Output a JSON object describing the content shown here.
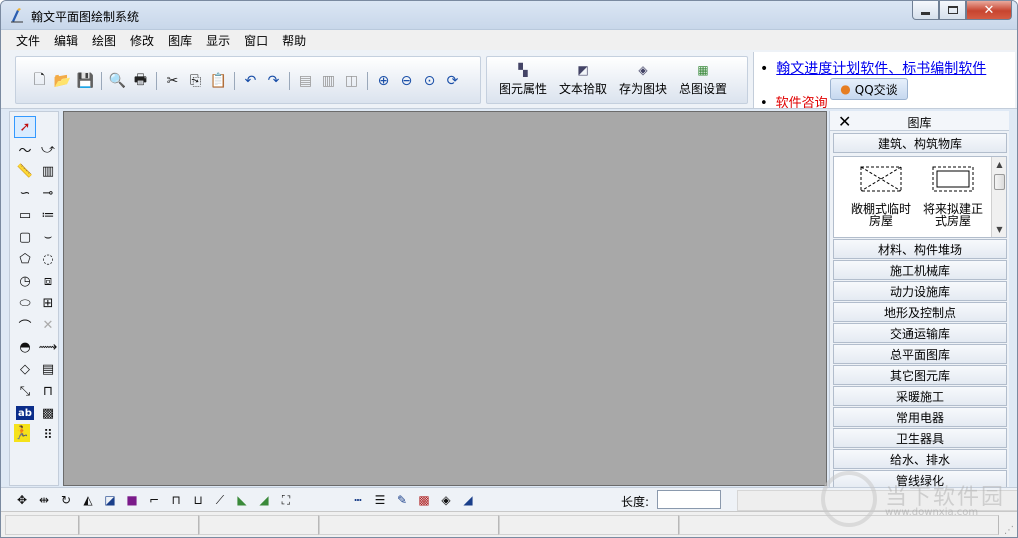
{
  "window": {
    "title": "翰文平面图绘制系统",
    "controls": {
      "minimize": "▭",
      "maximize": "▣",
      "close": "✕"
    }
  },
  "menu": [
    "文件",
    "编辑",
    "绘图",
    "修改",
    "图库",
    "显示",
    "窗口",
    "帮助"
  ],
  "toolbar": {
    "icons": [
      "new-file",
      "open-folder",
      "save",
      "print-preview",
      "print",
      "cut",
      "copy",
      "paste",
      "undo",
      "redo",
      "layer-front",
      "layer-back",
      "layer-split",
      "zoom-in",
      "zoom-out",
      "zoom-window",
      "zoom-realtime"
    ],
    "buttons": [
      {
        "label": "图元属性",
        "icon": "properties-icon"
      },
      {
        "label": "文本拾取",
        "icon": "text-pick-icon"
      },
      {
        "label": "存为图块",
        "icon": "save-block-icon"
      },
      {
        "label": "总图设置",
        "icon": "settings-icon"
      }
    ]
  },
  "news": {
    "link_text": "翰文进度计划软件、标书编制软件",
    "consult_text": "软件咨询",
    "qq_button": "QQ交谈"
  },
  "tools": [
    "select-arrow",
    "",
    "line",
    "polyline",
    "ruler",
    "hatch-line",
    "arc-curve",
    "dimension-line",
    "rectangle",
    "text-lines",
    "rounded-rect",
    "bracket-shape",
    "pentagon",
    "circle-dash",
    "compass-circle",
    "square-frame",
    "ellipse",
    "block-shape",
    "freehand-arc",
    "cross-disabled",
    "half-circle",
    "wave-line",
    "diamond-shape",
    "stripe-block",
    "tilted-line",
    "gate-structure",
    "text-ab",
    "hatch-fill",
    "running-man",
    "grid-dots"
  ],
  "library": {
    "title": "图库",
    "first_category": "建筑、构筑物库",
    "gallery_items": [
      "敞棚式临时房屋",
      "将来拟建正式房屋"
    ],
    "categories": [
      "材料、构件堆场",
      "施工机械库",
      "动力设施库",
      "地形及控制点",
      "交通运输库",
      "总平面图库",
      "其它图元库",
      "采暖施工",
      "常用电器",
      "卫生器具",
      "给水、排水",
      "管线绿化"
    ]
  },
  "bottombar": {
    "length_label": "长度:",
    "length_value": ""
  },
  "watermark": {
    "text": "当下软件园",
    "url": "www.downxia.com"
  }
}
